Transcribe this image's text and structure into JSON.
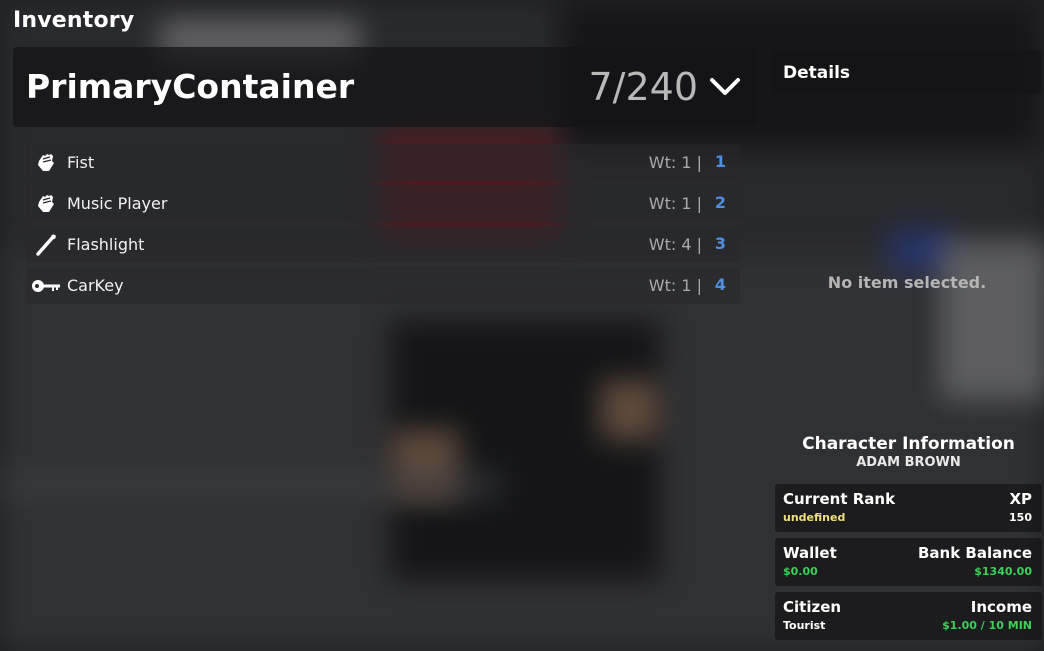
{
  "inventory": {
    "title": "Inventory",
    "container_name": "PrimaryContainer",
    "capacity": "7/240",
    "items": [
      {
        "name": "Fist",
        "weight": "Wt: 1 |",
        "slot": "1",
        "icon": "fist-icon"
      },
      {
        "name": "Music Player",
        "weight": "Wt: 1 |",
        "slot": "2",
        "icon": "fist-icon"
      },
      {
        "name": "Flashlight",
        "weight": "Wt: 4 |",
        "slot": "3",
        "icon": "flashlight-icon"
      },
      {
        "name": "CarKey",
        "weight": "Wt: 1 |",
        "slot": "4",
        "icon": "key-icon"
      }
    ]
  },
  "details": {
    "title": "Details",
    "empty_text": "No item selected."
  },
  "character": {
    "title": "Character Information",
    "name": "ADAM BROWN",
    "rank_label": "Current Rank",
    "rank_value": "undefined",
    "xp_label": "XP",
    "xp_value": "150",
    "wallet_label": "Wallet",
    "wallet_value": "$0.00",
    "bank_label": "Bank Balance",
    "bank_value": "$1340.00",
    "citizen_label": "Citizen",
    "citizen_value": "Tourist",
    "income_label": "Income",
    "income_value": "$1.00 / 10 MIN"
  },
  "colors": {
    "slot_number": "#4f8fe0",
    "rank_value": "#f0e07a",
    "money_green": "#3ccf5a"
  }
}
